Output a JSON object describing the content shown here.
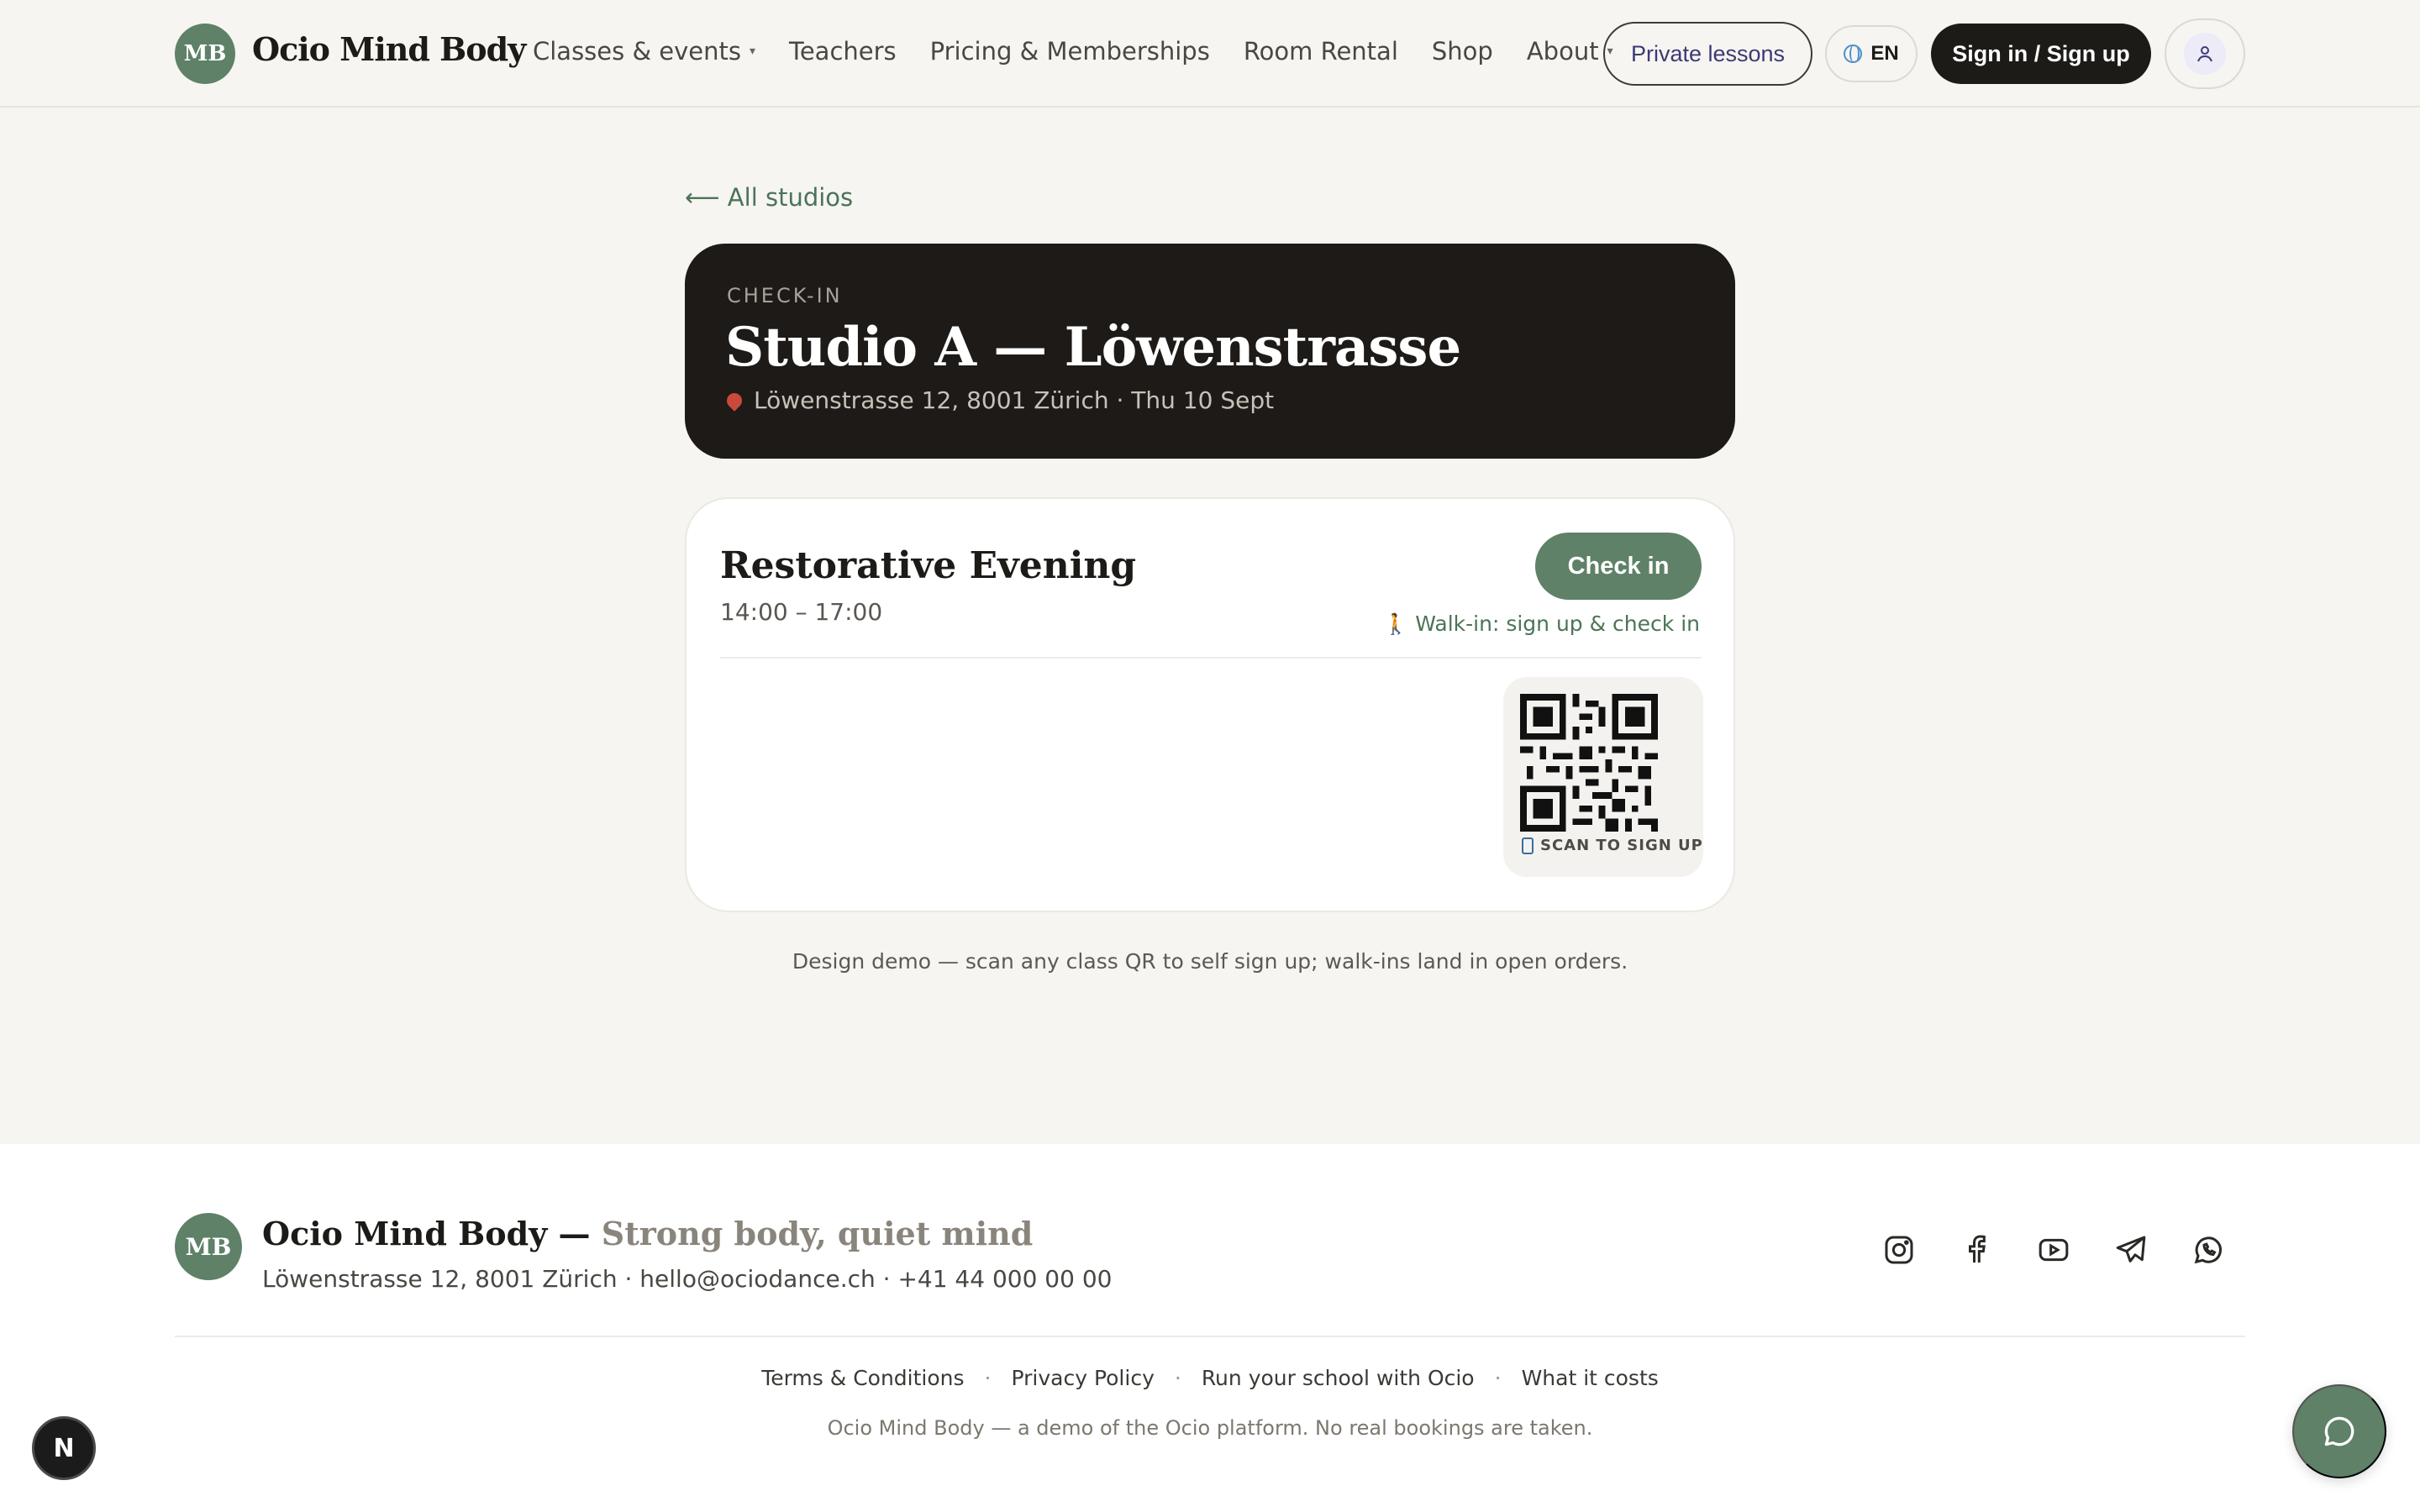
{
  "header": {
    "logo_initials": "MB",
    "brand": "Ocio Mind Body",
    "nav": [
      {
        "label": "Classes & events",
        "dropdown": true
      },
      {
        "label": "Teachers",
        "dropdown": false
      },
      {
        "label": "Pricing & Memberships",
        "dropdown": false
      },
      {
        "label": "Room Rental",
        "dropdown": false
      },
      {
        "label": "Shop",
        "dropdown": false
      },
      {
        "label": "About",
        "dropdown": true
      }
    ],
    "private_lessons": "Private lessons",
    "language": "EN",
    "sign_in": "Sign in / Sign up"
  },
  "main": {
    "back_link": "⟵ All studios",
    "hero": {
      "kicker": "CHECK-IN",
      "title": "Studio A — Löwenstrasse",
      "subtitle": "Löwenstrasse 12, 8001 Zürich · Thu 10 Sept"
    },
    "class": {
      "title": "Restorative Evening",
      "time": "14:00 – 17:00",
      "check_in_button": "Check in",
      "walk_in": "Walk-in: sign up & check in",
      "qr_caption": "SCAN TO SIGN UP"
    },
    "demo_note": "Design demo — scan any class QR to self sign up; walk-ins land in open orders."
  },
  "footer": {
    "logo_initials": "MB",
    "brand": "Ocio Mind Body — ",
    "tagline": "Strong body, quiet mind",
    "contact": "Löwenstrasse 12, 8001 Zürich · hello@ociodance.ch · +41 44 000 00 00",
    "socials": [
      "instagram-icon",
      "facebook-icon",
      "youtube-icon",
      "telegram-icon",
      "whatsapp-icon"
    ],
    "links": [
      "Terms & Conditions",
      "Privacy Policy",
      "Run your school with Ocio",
      "What it costs"
    ],
    "note": "Ocio Mind Body — a demo of the Ocio platform. No real bookings are taken."
  },
  "floating": {
    "n_badge": "N"
  },
  "colors": {
    "accent_green": "#5e8168",
    "dark": "#1d1a17",
    "background": "#f6f5f1"
  }
}
